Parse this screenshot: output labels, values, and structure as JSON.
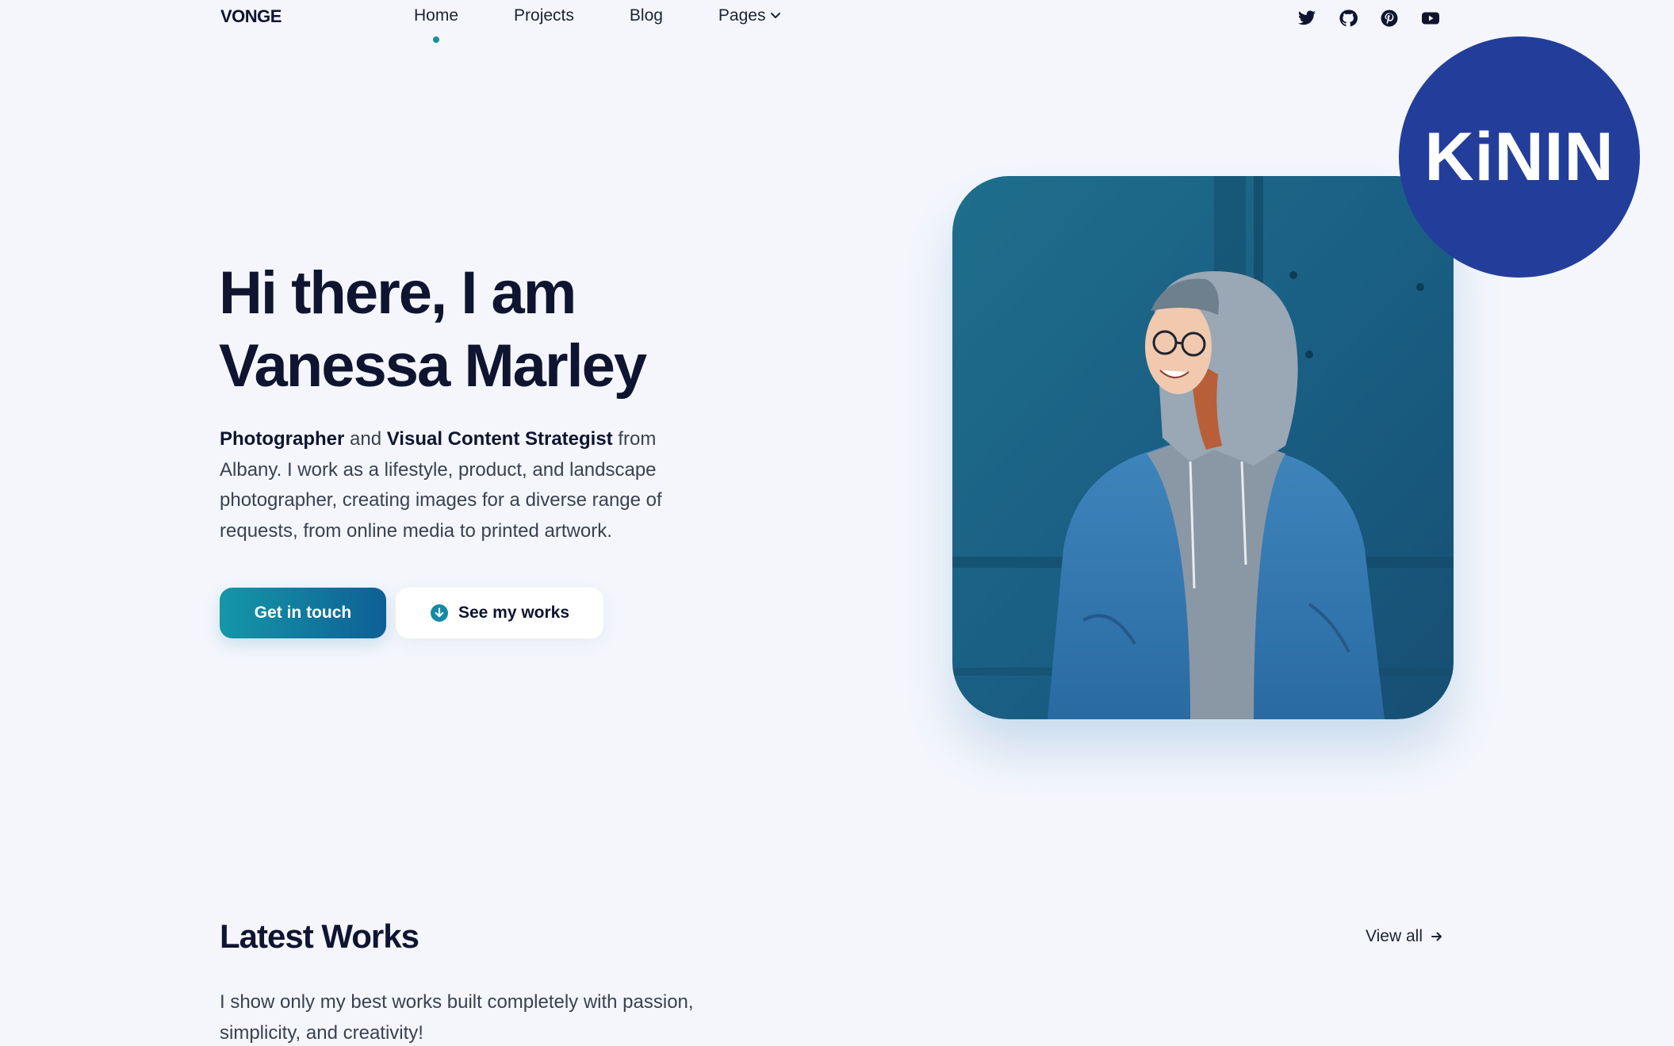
{
  "header": {
    "logo": "VONGE",
    "nav": [
      {
        "label": "Home",
        "active": true
      },
      {
        "label": "Projects",
        "active": false
      },
      {
        "label": "Blog",
        "active": false
      },
      {
        "label": "Pages",
        "active": false,
        "has_dropdown": true
      }
    ],
    "socials": [
      "twitter-icon",
      "github-icon",
      "pinterest-icon",
      "youtube-icon"
    ]
  },
  "hero": {
    "title_line1": "Hi there, I am",
    "title_line2": "Vanessa Marley",
    "desc_bold1": "Photographer",
    "desc_and": " and ",
    "desc_bold2": "Visual Content Strategist",
    "desc_rest": " from Albany. I work as a lifestyle, product, and landscape photographer, creating images for a diverse range of requests, from online media to printed artwork.",
    "primary_button": "Get in touch",
    "secondary_button": "See my works"
  },
  "badge": {
    "text": "KiNIN"
  },
  "latest_works": {
    "title": "Latest Works",
    "view_all": "View all",
    "description": "I show only my best works built completely with passion, simplicity, and creativity!"
  },
  "colors": {
    "background": "#f4f6fc",
    "accent": "#15919b",
    "button_gradient_start": "#1597a7",
    "button_gradient_end": "#0e5f95",
    "badge": "#233e9a",
    "heading": "#0f1530"
  }
}
